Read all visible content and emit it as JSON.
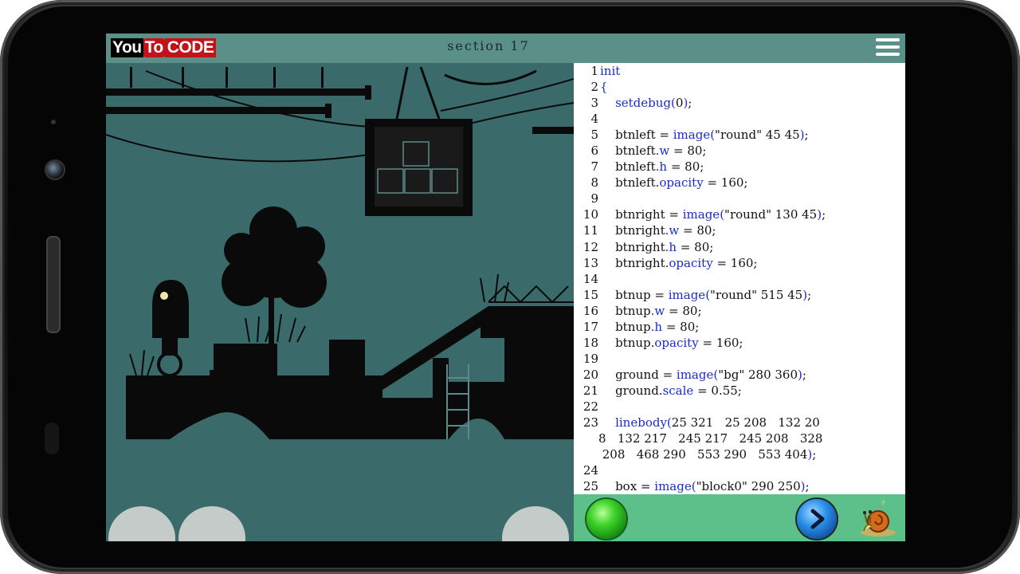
{
  "app": {
    "logo_you": "You",
    "logo_to": "To",
    "logo_code": "CODE",
    "section_title": "section 17"
  },
  "icons": {
    "menu": "hamburger-menu-icon",
    "run": "green-run-icon",
    "next": "blue-next-arrow-icon",
    "snail": "snail-mascot-icon"
  },
  "colors": {
    "topbar": "#5a9088",
    "game_bg": "#3b6a6a",
    "bottombar": "#5dbf8a",
    "keyword": "#1a2cc8"
  },
  "code": {
    "lines": [
      {
        "n": "1",
        "t": "init"
      },
      {
        "n": "2",
        "t": "{"
      },
      {
        "n": "3",
        "t": "    setdebug(0);"
      },
      {
        "n": "4",
        "t": ""
      },
      {
        "n": "5",
        "t": "    btnleft = image(\"round\" 45 45);"
      },
      {
        "n": "6",
        "t": "    btnleft.w = 80;"
      },
      {
        "n": "7",
        "t": "    btnleft.h = 80;"
      },
      {
        "n": "8",
        "t": "    btnleft.opacity = 160;"
      },
      {
        "n": "9",
        "t": ""
      },
      {
        "n": "10",
        "t": "    btnright = image(\"round\" 130 45);"
      },
      {
        "n": "11",
        "t": "    btnright.w = 80;"
      },
      {
        "n": "12",
        "t": "    btnright.h = 80;"
      },
      {
        "n": "13",
        "t": "    btnright.opacity = 160;"
      },
      {
        "n": "14",
        "t": ""
      },
      {
        "n": "15",
        "t": "    btnup = image(\"round\" 515 45);"
      },
      {
        "n": "16",
        "t": "    btnup.w = 80;"
      },
      {
        "n": "17",
        "t": "    btnup.h = 80;"
      },
      {
        "n": "18",
        "t": "    btnup.opacity = 160;"
      },
      {
        "n": "19",
        "t": ""
      },
      {
        "n": "20",
        "t": "    ground = image(\"bg\" 280 360);"
      },
      {
        "n": "21",
        "t": "    ground.scale = 0.55;"
      },
      {
        "n": "22",
        "t": ""
      },
      {
        "n": "23",
        "t": "    linebody(25 321   25 208   132 20"
      },
      {
        "n": "",
        "t": "8   132 217   245 217   245 208   328"
      },
      {
        "n": "",
        "t": " 208   468 290   553 290   553 404);"
      },
      {
        "n": "24",
        "t": ""
      },
      {
        "n": "25",
        "t": "    box = image(\"block0\" 290 250);"
      }
    ]
  }
}
